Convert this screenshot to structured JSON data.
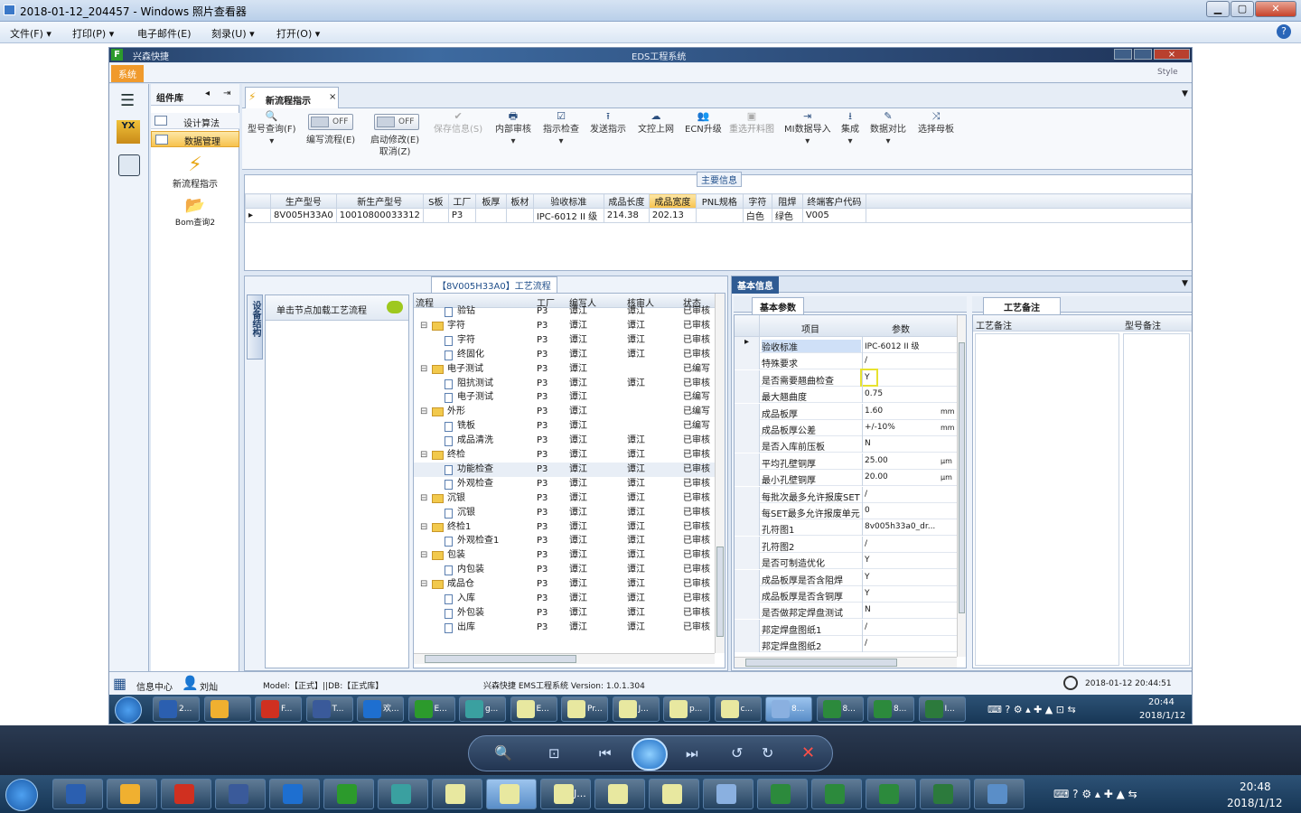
{
  "viewer": {
    "title": "2018-01-12_204457 - Windows 照片查看器",
    "menus": [
      "文件(F)",
      "打印(P)",
      "电子邮件(E)",
      "刻录(U)",
      "打开(O)"
    ]
  },
  "app": {
    "company": "兴森快捷",
    "title": "EDS工程系统",
    "ribbon_tab": "系统",
    "style_label": "Style"
  },
  "group_panel": {
    "title": "组件库",
    "items": [
      "设计算法",
      "数据管理"
    ],
    "tools": [
      "新流程指示",
      "Bom查询2"
    ]
  },
  "doc_tab": {
    "label": "新流程指示",
    "close": "×"
  },
  "toolbar": {
    "query": "型号查询(F)",
    "edit_flow": "编写流程(E)",
    "toggle1": "OFF",
    "start_modify": "启动修改(E)",
    "cancel_z": "取消(Z)",
    "toggle2": "OFF",
    "save": "保存信息(S)",
    "internal": "内部审核",
    "indicate": "指示检查",
    "send": "发送指示",
    "upload": "文控上网",
    "ecn": "ECN升级",
    "reselect": "重选开料图",
    "mi_import": "MI数据导入",
    "collect": "集成",
    "compare": "数据对比",
    "select_mother": "选择母板"
  },
  "main_info": {
    "title": "主要信息",
    "headers": [
      "生产型号",
      "新生产型号",
      "S板",
      "工厂",
      "板厚",
      "板材",
      "验收标准",
      "成品长度",
      "成品宽度",
      "PNL规格",
      "字符",
      "阻焊",
      "终端客户代码"
    ],
    "row": [
      "8V005H33A0",
      "10010800033312",
      "",
      "P3",
      "",
      "",
      "IPC-6012 II 级",
      "214.38",
      "202.13",
      "",
      "白色",
      "绿色",
      "V005"
    ]
  },
  "process_panel": {
    "title": "【8V005H33A0】工艺流程",
    "side_tab": "设备结构",
    "hint": "单击节点加载工艺流程",
    "headers": [
      "流程",
      "工厂",
      "编写人",
      "核审人",
      "状态"
    ],
    "rows": [
      {
        "name": "验钻",
        "indent": 2,
        "folder": false,
        "factory": "P3",
        "writer": "谭江",
        "checker": "谭江",
        "status": "已审核"
      },
      {
        "name": "字符",
        "indent": 1,
        "folder": true,
        "factory": "P3",
        "writer": "谭江",
        "checker": "谭江",
        "status": "已审核"
      },
      {
        "name": "字符",
        "indent": 2,
        "folder": false,
        "factory": "P3",
        "writer": "谭江",
        "checker": "谭江",
        "status": "已审核"
      },
      {
        "name": "终固化",
        "indent": 2,
        "folder": false,
        "factory": "P3",
        "writer": "谭江",
        "checker": "谭江",
        "status": "已审核"
      },
      {
        "name": "电子测试",
        "indent": 1,
        "folder": true,
        "factory": "P3",
        "writer": "谭江",
        "checker": "",
        "status": "已编写"
      },
      {
        "name": "阻抗测试",
        "indent": 2,
        "folder": false,
        "factory": "P3",
        "writer": "谭江",
        "checker": "谭江",
        "status": "已审核"
      },
      {
        "name": "电子测试",
        "indent": 2,
        "folder": false,
        "factory": "P3",
        "writer": "谭江",
        "checker": "",
        "status": "已编写"
      },
      {
        "name": "外形",
        "indent": 1,
        "folder": true,
        "factory": "P3",
        "writer": "谭江",
        "checker": "",
        "status": "已编写"
      },
      {
        "name": "铣板",
        "indent": 2,
        "folder": false,
        "factory": "P3",
        "writer": "谭江",
        "checker": "",
        "status": "已编写"
      },
      {
        "name": "成品清洗",
        "indent": 2,
        "folder": false,
        "factory": "P3",
        "writer": "谭江",
        "checker": "谭江",
        "status": "已审核"
      },
      {
        "name": "终检",
        "indent": 1,
        "folder": true,
        "factory": "P3",
        "writer": "谭江",
        "checker": "谭江",
        "status": "已审核"
      },
      {
        "name": "功能检查",
        "indent": 2,
        "folder": false,
        "factory": "P3",
        "writer": "谭江",
        "checker": "谭江",
        "status": "已审核"
      },
      {
        "name": "外观检查",
        "indent": 2,
        "folder": false,
        "factory": "P3",
        "writer": "谭江",
        "checker": "谭江",
        "status": "已审核"
      },
      {
        "name": "沉银",
        "indent": 1,
        "folder": true,
        "factory": "P3",
        "writer": "谭江",
        "checker": "谭江",
        "status": "已审核"
      },
      {
        "name": "沉银",
        "indent": 2,
        "folder": false,
        "factory": "P3",
        "writer": "谭江",
        "checker": "谭江",
        "status": "已审核"
      },
      {
        "name": "终检1",
        "indent": 1,
        "folder": true,
        "factory": "P3",
        "writer": "谭江",
        "checker": "谭江",
        "status": "已审核"
      },
      {
        "name": "外观检查1",
        "indent": 2,
        "folder": false,
        "factory": "P3",
        "writer": "谭江",
        "checker": "谭江",
        "status": "已审核"
      },
      {
        "name": "包装",
        "indent": 1,
        "folder": true,
        "factory": "P3",
        "writer": "谭江",
        "checker": "谭江",
        "status": "已审核"
      },
      {
        "name": "内包装",
        "indent": 2,
        "folder": false,
        "factory": "P3",
        "writer": "谭江",
        "checker": "谭江",
        "status": "已审核"
      },
      {
        "name": "成品仓",
        "indent": 1,
        "folder": true,
        "factory": "P3",
        "writer": "谭江",
        "checker": "谭江",
        "status": "已审核"
      },
      {
        "name": "入库",
        "indent": 2,
        "folder": false,
        "factory": "P3",
        "writer": "谭江",
        "checker": "谭江",
        "status": "已审核"
      },
      {
        "name": "外包装",
        "indent": 2,
        "folder": false,
        "factory": "P3",
        "writer": "谭江",
        "checker": "谭江",
        "status": "已审核"
      },
      {
        "name": "出库",
        "indent": 2,
        "folder": false,
        "factory": "P3",
        "writer": "谭江",
        "checker": "谭江",
        "status": "已审核"
      }
    ]
  },
  "basic_info": {
    "title": "基本信息",
    "tab_params": "基本参数",
    "tab_remarks": "工艺备注",
    "headers": [
      "项目",
      "参数"
    ],
    "remark_headers": [
      "工艺备注",
      "型号备注"
    ],
    "rows": [
      {
        "item": "验收标准",
        "value": "IPC-6012 II 级",
        "unit": ""
      },
      {
        "item": "特殊要求",
        "value": "/",
        "unit": ""
      },
      {
        "item": "是否需要翘曲检查",
        "value": "Y",
        "unit": ""
      },
      {
        "item": "最大翘曲度",
        "value": "0.75",
        "unit": ""
      },
      {
        "item": "成品板厚",
        "value": "1.60",
        "unit": "mm"
      },
      {
        "item": "成品板厚公差",
        "value": "+/-10%",
        "unit": "mm"
      },
      {
        "item": "是否入库前压板",
        "value": "N",
        "unit": ""
      },
      {
        "item": "平均孔壁铜厚",
        "value": "25.00",
        "unit": "μm"
      },
      {
        "item": "最小孔壁铜厚",
        "value": "20.00",
        "unit": "μm"
      },
      {
        "item": "每批次最多允许报废SET",
        "value": "/",
        "unit": ""
      },
      {
        "item": "每SET最多允许报废单元",
        "value": "0",
        "unit": ""
      },
      {
        "item": "孔符图1",
        "value": "8v005h33a0_dr...",
        "unit": ""
      },
      {
        "item": "孔符图2",
        "value": "/",
        "unit": ""
      },
      {
        "item": "是否可制造优化",
        "value": "Y",
        "unit": ""
      },
      {
        "item": "成品板厚是否含阻焊",
        "value": "Y",
        "unit": ""
      },
      {
        "item": "成品板厚是否含铜厚",
        "value": "Y",
        "unit": ""
      },
      {
        "item": "是否做邦定焊盘测试",
        "value": "N",
        "unit": ""
      },
      {
        "item": "邦定焊盘图纸1",
        "value": "/",
        "unit": ""
      },
      {
        "item": "邦定焊盘图纸2",
        "value": "/",
        "unit": ""
      }
    ]
  },
  "statusbar": {
    "info_center": "信息中心",
    "user": "刘灿",
    "model": "Model:【正式】||DB:【正式库】",
    "version": "兴森快捷 EMS工程系统 Version: 1.0.1.304",
    "datetime": "2018-01-12 20:44:51"
  },
  "inner_taskbar": {
    "items": [
      "2...",
      "",
      "F...",
      "T...",
      "欢...",
      "E...",
      "g...",
      "E...",
      "Pr...",
      "J...",
      "p...",
      "c...",
      "8...",
      "8...",
      "8...",
      "I..."
    ],
    "time": "20:44",
    "date": "2018/1/12"
  },
  "outer_taskbar": {
    "items": [
      "J..."
    ],
    "time": "20:48",
    "date": "2018/1/12"
  }
}
